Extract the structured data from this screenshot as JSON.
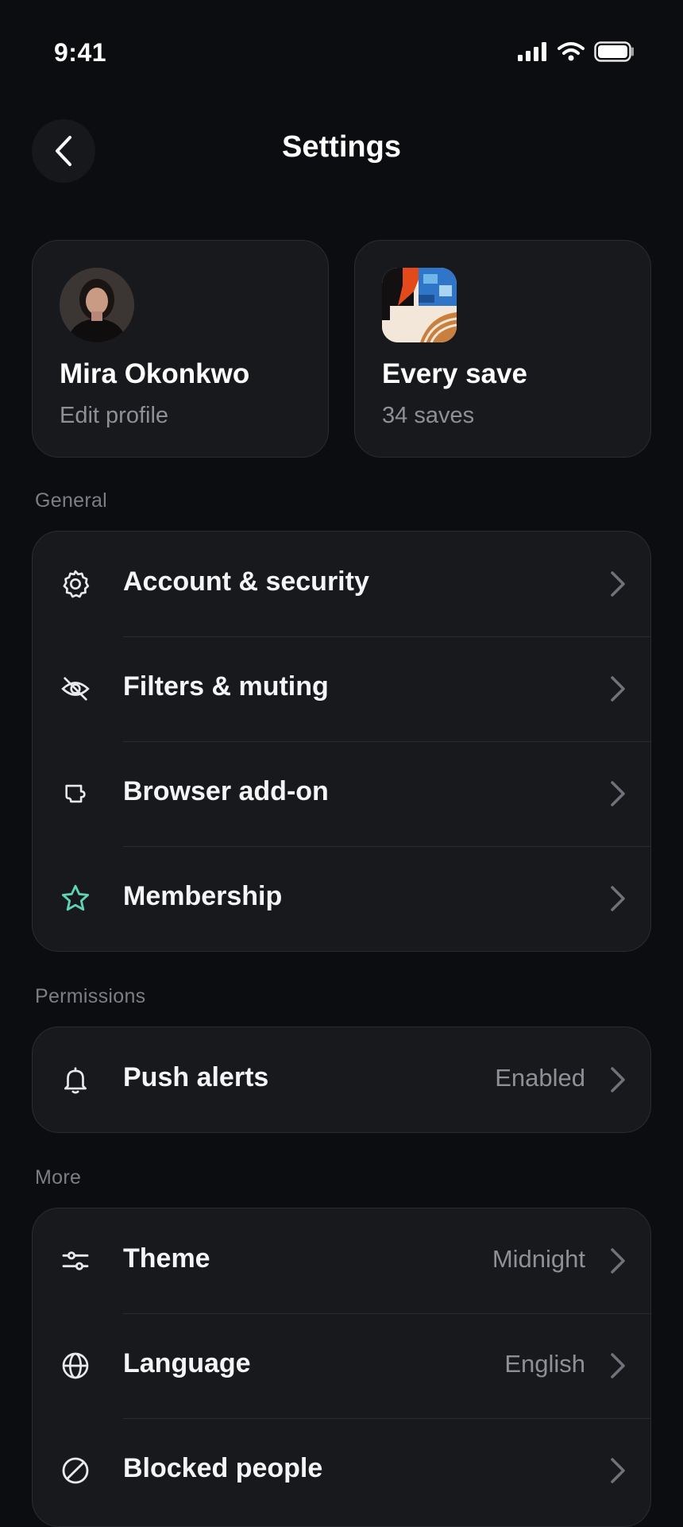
{
  "status_bar": {
    "time": "9:41"
  },
  "header": {
    "title": "Settings"
  },
  "profile_card": {
    "name": "Mira Okonkwo",
    "subtitle": "Edit profile"
  },
  "saves_card": {
    "title": "Every save",
    "subtitle": "34 saves"
  },
  "sections": {
    "general": {
      "label": "General",
      "items": [
        {
          "label": "Account & security",
          "icon": "gear-icon"
        },
        {
          "label": "Filters & muting",
          "icon": "eye-off-icon"
        },
        {
          "label": "Browser add-on",
          "icon": "puzzle-icon"
        },
        {
          "label": "Membership",
          "icon": "star-icon"
        }
      ]
    },
    "permissions": {
      "label": "Permissions",
      "items": [
        {
          "label": "Push alerts",
          "value": "Enabled",
          "icon": "bell-icon"
        }
      ]
    },
    "more": {
      "label": "More",
      "items": [
        {
          "label": "Theme",
          "value": "Midnight",
          "icon": "sliders-icon"
        },
        {
          "label": "Language",
          "value": "English",
          "icon": "globe-icon"
        },
        {
          "label": "Blocked people",
          "icon": "blocked-icon"
        }
      ]
    }
  },
  "colors": {
    "accent_star": "#5fd3b8",
    "background": "#0c0d10",
    "card": "#18191d"
  }
}
